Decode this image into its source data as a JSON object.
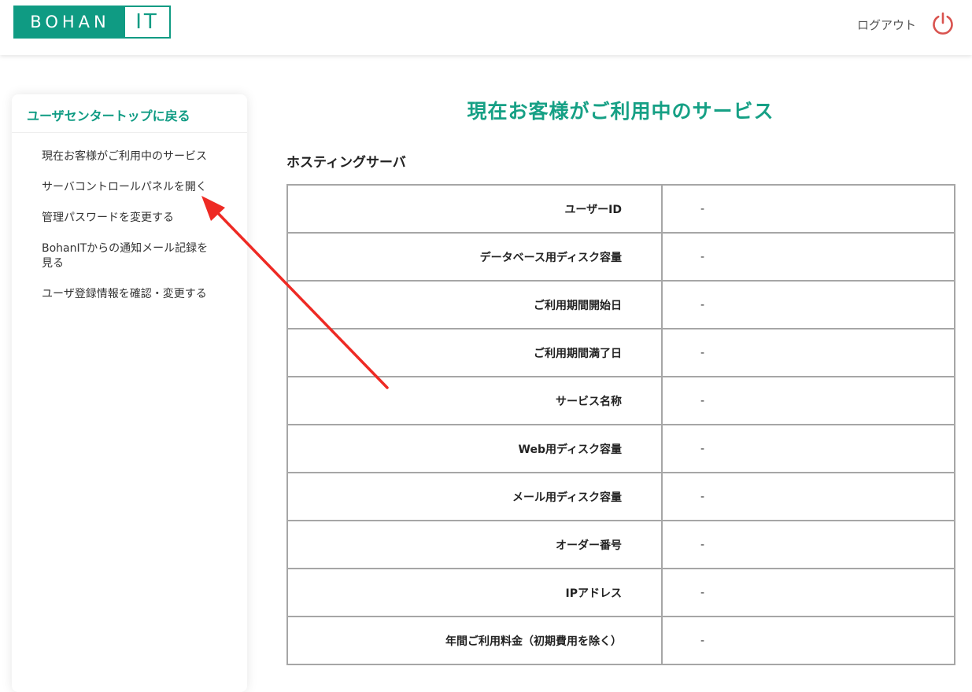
{
  "header": {
    "logo_left": "BOHAN",
    "logo_right": "IT",
    "logout_label": "ログアウト",
    "power_icon": "power-icon",
    "accent_color": "#0f9b83",
    "power_color": "#d9534f"
  },
  "sidebar": {
    "back_label": "ユーザセンタートップに戻る",
    "items": [
      {
        "label": "現在お客様がご利用中のサービス"
      },
      {
        "label": "サーバコントロールパネルを開く"
      },
      {
        "label": "管理パスワードを変更する"
      },
      {
        "label": "BohanITからの通知メール記録を見る"
      },
      {
        "label": "ユーザ登録情報を確認・変更する"
      }
    ]
  },
  "main": {
    "title": "現在お客様がご利用中のサービス",
    "section_title": "ホスティングサーバ",
    "rows": [
      {
        "label": "ユーザーID",
        "value": "-"
      },
      {
        "label": "データベース用ディスク容量",
        "value": "-"
      },
      {
        "label": "ご利用期間開始日",
        "value": "-"
      },
      {
        "label": "ご利用期間満了日",
        "value": "-"
      },
      {
        "label": "サービス名称",
        "value": "-"
      },
      {
        "label": "Web用ディスク容量",
        "value": "-"
      },
      {
        "label": "メール用ディスク容量",
        "value": "-"
      },
      {
        "label": "オーダー番号",
        "value": "-"
      },
      {
        "label": "IPアドレス",
        "value": "-"
      },
      {
        "label": "年間ご利用料金（初期費用を除く）",
        "value": "-"
      }
    ]
  },
  "annotation": {
    "arrow_color": "#ee2a24",
    "arrow_target": "sidebar-item-open-control-panel"
  }
}
